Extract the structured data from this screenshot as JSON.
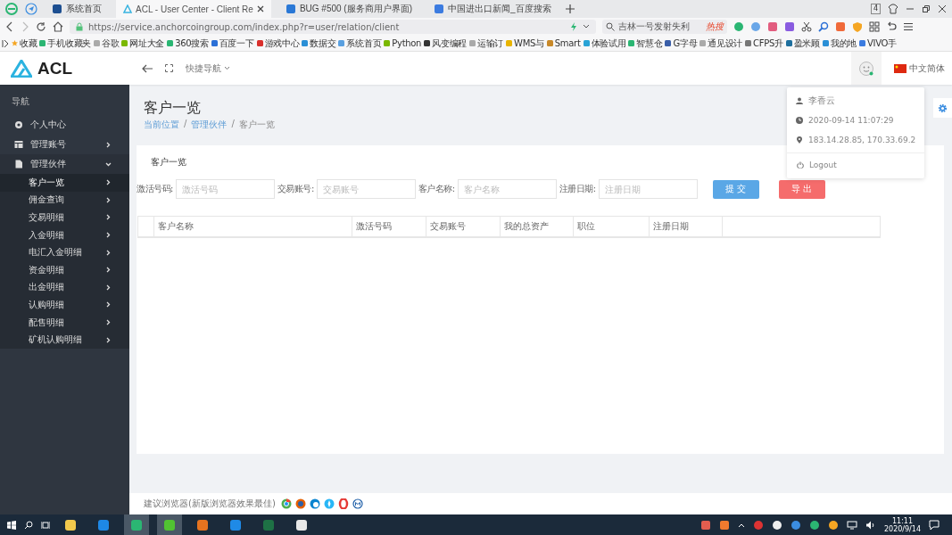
{
  "browser": {
    "tabs": [
      {
        "title": "系统首页",
        "selected": false
      },
      {
        "title": "ACL - User Center - Client Re",
        "selected": true
      },
      {
        "title": "BUG #500 (服务商用户界面)",
        "selected": false
      },
      {
        "title": "中国进出口新闻_百度搜索",
        "selected": false
      }
    ],
    "tab_count": "4",
    "address": "https://service.anchorcoingroup.com/index.php?r=user/relation/client",
    "search": {
      "value": "吉林一号发射失利",
      "badge": "热搜"
    },
    "bookmarks": [
      "收藏",
      "手机收藏夹",
      "谷歌",
      "网址大全",
      "360搜索",
      "百度一下",
      "游戏中心",
      "数据交",
      "系统首页",
      "Python",
      "风变编程",
      "运输订",
      "WMS与",
      "Smart",
      "体验试用",
      "智慧仓",
      "G字母",
      "通见设计",
      "CFPS升",
      "盈米顾",
      "我的地",
      "VIVO手"
    ]
  },
  "app": {
    "logo": "ACL",
    "quick_nav": "快捷导航",
    "language": "中文简体"
  },
  "sidebar": {
    "heading": "导航",
    "items": [
      {
        "label": "个人中心",
        "kind": "link",
        "selected": false
      },
      {
        "label": "管理账号",
        "kind": "group",
        "expanded": false,
        "selected": false
      },
      {
        "label": "管理伙伴",
        "kind": "group",
        "expanded": true,
        "selected": false,
        "children": [
          {
            "label": "客户一览",
            "selected": true
          },
          {
            "label": "佣金查询",
            "selected": false
          },
          {
            "label": "交易明细",
            "selected": false
          },
          {
            "label": "入金明细",
            "selected": false
          },
          {
            "label": "电汇入金明细",
            "selected": false
          },
          {
            "label": "资金明细",
            "selected": false
          },
          {
            "label": "出金明细",
            "selected": false
          },
          {
            "label": "认购明细",
            "selected": false
          },
          {
            "label": "配售明细",
            "selected": false
          },
          {
            "label": "矿机认购明细",
            "selected": false
          }
        ]
      }
    ]
  },
  "page": {
    "title": "客户一览",
    "separator": "/",
    "breadcrumb": [
      {
        "label": "当前位置",
        "link": true
      },
      {
        "label": "管理伙伴",
        "link": true
      },
      {
        "label": "客户一览",
        "link": false
      }
    ]
  },
  "card": {
    "title": "客户一览",
    "filters": [
      {
        "label": "激活号码:",
        "placeholder": "激活号码"
      },
      {
        "label": "交易账号:",
        "placeholder": "交易账号"
      },
      {
        "label": "客户名称:",
        "placeholder": "客户名称"
      },
      {
        "label": "注册日期:",
        "placeholder": "注册日期"
      }
    ],
    "buttons": [
      {
        "label": "提 交",
        "kind": "primary"
      },
      {
        "label": "导 出",
        "kind": "danger"
      }
    ],
    "table": {
      "columns": [
        "客户名称",
        "激活号码",
        "交易账号",
        "我的总资产",
        "职位",
        "注册日期"
      ]
    }
  },
  "user_menu": {
    "items": [
      {
        "kind": "user",
        "text": "李香云"
      },
      {
        "kind": "time",
        "text": "2020-09-14 11:07:29"
      },
      {
        "kind": "location",
        "text": "183.14.28.85, 170.33.69.2"
      },
      {
        "kind": "logout",
        "text": "Logout"
      }
    ]
  },
  "footer": {
    "text": "建议浏览器(新版浏览器效果最佳)"
  },
  "taskbar": {
    "time": "11:11",
    "date": "2020/9/14"
  }
}
